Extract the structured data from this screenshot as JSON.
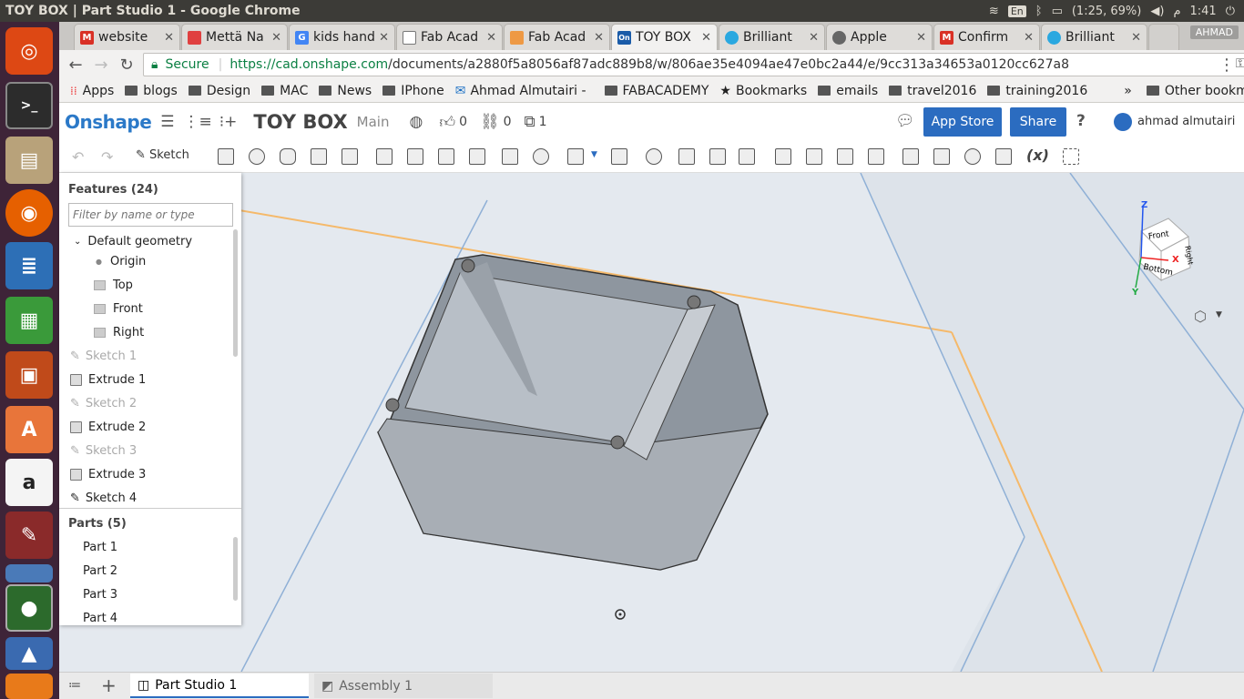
{
  "os": {
    "window_title": "TOY BOX | Part Studio 1 - Google Chrome",
    "kbd_layout": "En",
    "battery": "(1:25, 69%)",
    "time": "1:41",
    "ampm": "م"
  },
  "launcher_icons": [
    "ubuntu-icon",
    "terminal-icon",
    "files-icon",
    "firefox-icon",
    "writer-icon",
    "calc-icon",
    "impress-icon",
    "software-center-icon",
    "amazon-icon",
    "settings-icon",
    "chromium-icon",
    "chrome-icon",
    "photos-icon",
    "blender-icon"
  ],
  "tabs": [
    {
      "label": "website",
      "color": "#d93025",
      "glyph": "M"
    },
    {
      "label": "Mettä Na",
      "color": "#e04040",
      "glyph": ""
    },
    {
      "label": "kids hand",
      "color": "#4285f4",
      "glyph": "G"
    },
    {
      "label": "Fab Acad",
      "color": "#777",
      "glyph": ""
    },
    {
      "label": "Fab Acad",
      "color": "#e94",
      "glyph": ""
    },
    {
      "label": "TOY BOX",
      "color": "#1a5ba8",
      "glyph": "On"
    },
    {
      "label": "Brilliant",
      "color": "#2aa8e0",
      "glyph": ""
    },
    {
      "label": "Apple",
      "color": "#666",
      "glyph": ""
    },
    {
      "label": "Confirm",
      "color": "#d93025",
      "glyph": "M"
    },
    {
      "label": "Brilliant",
      "color": "#2aa8e0",
      "glyph": ""
    }
  ],
  "profile_name": "AHMAD",
  "address": {
    "secure": "Secure",
    "url_host": "https://cad.onshape.com",
    "url_path": "/documents/a2880f5a8056af87adc889b8/w/806ae35e4094ae47e0bc2a44/e/9cc313a34653a0120cc627a8"
  },
  "bookmarks": [
    {
      "label": "Apps",
      "kind": "apps"
    },
    {
      "label": "blogs",
      "kind": "folder"
    },
    {
      "label": "Design",
      "kind": "folder"
    },
    {
      "label": "MAC",
      "kind": "folder"
    },
    {
      "label": "News",
      "kind": "folder"
    },
    {
      "label": "IPhone",
      "kind": "folder"
    },
    {
      "label": "Ahmad Almutairi -",
      "kind": "mail"
    },
    {
      "label": "FABACADEMY",
      "kind": "folder"
    },
    {
      "label": "Bookmarks",
      "kind": "star"
    },
    {
      "label": "emails",
      "kind": "folder"
    },
    {
      "label": "travel2016",
      "kind": "folder"
    },
    {
      "label": "training2016",
      "kind": "folder"
    }
  ],
  "bookmarks_more": "»",
  "other_bookmarks": "Other bookmarks",
  "onshape": {
    "logo": "Onshape",
    "doc_title": "TOY BOX",
    "workspace": "Main",
    "likes": "0",
    "links": "0",
    "copies": "1",
    "app_store": "App Store",
    "share": "Share",
    "help": "?",
    "user": "ahmad almutairi"
  },
  "toolbar": {
    "sketch_label": "Sketch"
  },
  "features_panel": {
    "title": "Features (24)",
    "filter_placeholder": "Filter by name or type",
    "default_geometry": "Default geometry",
    "items": [
      {
        "label": "Origin",
        "kind": "origin"
      },
      {
        "label": "Top",
        "kind": "plane"
      },
      {
        "label": "Front",
        "kind": "plane"
      },
      {
        "label": "Right",
        "kind": "plane"
      },
      {
        "label": "Sketch 1",
        "kind": "sketch-dim"
      },
      {
        "label": "Extrude 1",
        "kind": "extrude"
      },
      {
        "label": "Sketch 2",
        "kind": "sketch-dim"
      },
      {
        "label": "Extrude 2",
        "kind": "extrude"
      },
      {
        "label": "Sketch 3",
        "kind": "sketch-dim"
      },
      {
        "label": "Extrude 3",
        "kind": "extrude"
      },
      {
        "label": "Sketch 4",
        "kind": "sketch"
      }
    ],
    "parts_title": "Parts (5)",
    "parts": [
      "Part 1",
      "Part 2",
      "Part 3",
      "Part 4"
    ]
  },
  "viewcube": {
    "front": "Front",
    "bottom": "Bottom",
    "right": "Right",
    "z": "Z",
    "x": "X",
    "y": "Y"
  },
  "bottom_tabs": [
    "Part Studio 1",
    "Assembly 1"
  ],
  "colors": {
    "brand": "#2b79c8",
    "button_blue": "#2b6cc0",
    "launcher_bg": "#3e2438",
    "topbar_bg": "#3c3b37"
  }
}
